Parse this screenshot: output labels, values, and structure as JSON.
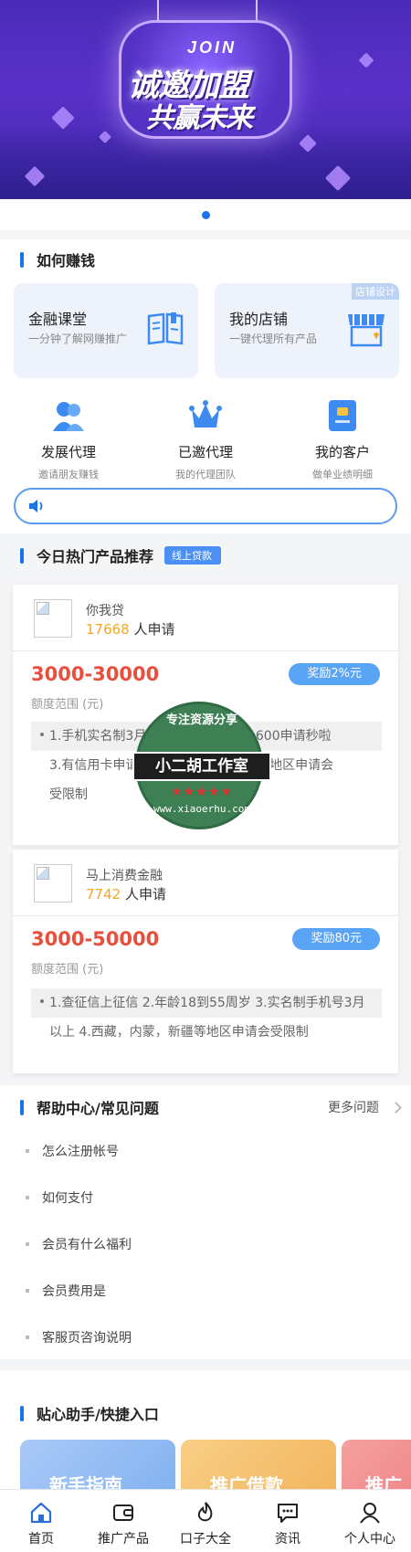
{
  "banner": {
    "join_text": "JOIN",
    "headline_1": "诚邀加盟",
    "headline_2": "共赢未来"
  },
  "how_to_earn": {
    "title": "如何赚钱",
    "cards": [
      {
        "title": "金融课堂",
        "subtitle": "一分钟了解网赚推广",
        "icon": "book-icon"
      },
      {
        "title": "我的店铺",
        "subtitle": "一键代理所有产品",
        "icon": "store-icon",
        "tag": "店铺设计"
      }
    ],
    "quick": [
      {
        "title": "发展代理",
        "subtitle": "邀请朋友赚钱",
        "icon": "users-icon"
      },
      {
        "title": "已邀代理",
        "subtitle": "我的代理团队",
        "icon": "crown-icon"
      },
      {
        "title": "我的客户",
        "subtitle": "做单业绩明细",
        "icon": "id-card-icon"
      }
    ]
  },
  "hot_products": {
    "title": "今日热门产品推荐",
    "tag": "线上贷款",
    "items": [
      {
        "name": "你我贷",
        "count": "17668",
        "count_suffix": "人申请",
        "range": "3000-30000",
        "range_label": "额度范围 (元)",
        "reward": "奖励2%元",
        "req_line1": "1.手机实名制3月 2.芝信用 3.芝麻分600申请秒啦",
        "req_line2": "3.有信用卡申请 4.西藏，内蒙，新疆等地区申请会",
        "req_line3": "受限制"
      },
      {
        "name": "马上消费金融",
        "count": "7742",
        "count_suffix": "人申请",
        "range": "3000-50000",
        "range_label": "额度范围 (元)",
        "reward": "奖励80元",
        "req_line1": "1.查征信上征信 2.年龄18到55周岁 3.实名制手机号3月",
        "req_line2": "以上 4.西藏，内蒙，新疆等地区申请会受限制"
      }
    ]
  },
  "watermark": {
    "top": "专注资源分享",
    "band": "小二胡工作室",
    "bottom": "www.xiaoerhu.com",
    "stars": "★★★★★"
  },
  "faq": {
    "title": "帮助中心/常见问题",
    "more": "更多问题",
    "items": [
      "怎么注册帐号",
      "如何支付",
      "会员有什么福利",
      "会员费用是",
      "客服页咨询说明"
    ]
  },
  "assistant": {
    "title": "贴心助手/快捷入口",
    "cards": [
      {
        "label": "新手指南",
        "color": "#9ec3f5"
      },
      {
        "label": "推广借款",
        "color": "#f6c277"
      },
      {
        "label": "推广",
        "color": "#f28a8a"
      }
    ]
  },
  "tabbar": [
    {
      "label": "首页",
      "icon": "home-icon"
    },
    {
      "label": "推广产品",
      "icon": "wallet-icon"
    },
    {
      "label": "口子大全",
      "icon": "fire-icon"
    },
    {
      "label": "资讯",
      "icon": "chat-icon"
    },
    {
      "label": "个人中心",
      "icon": "user-icon"
    }
  ]
}
